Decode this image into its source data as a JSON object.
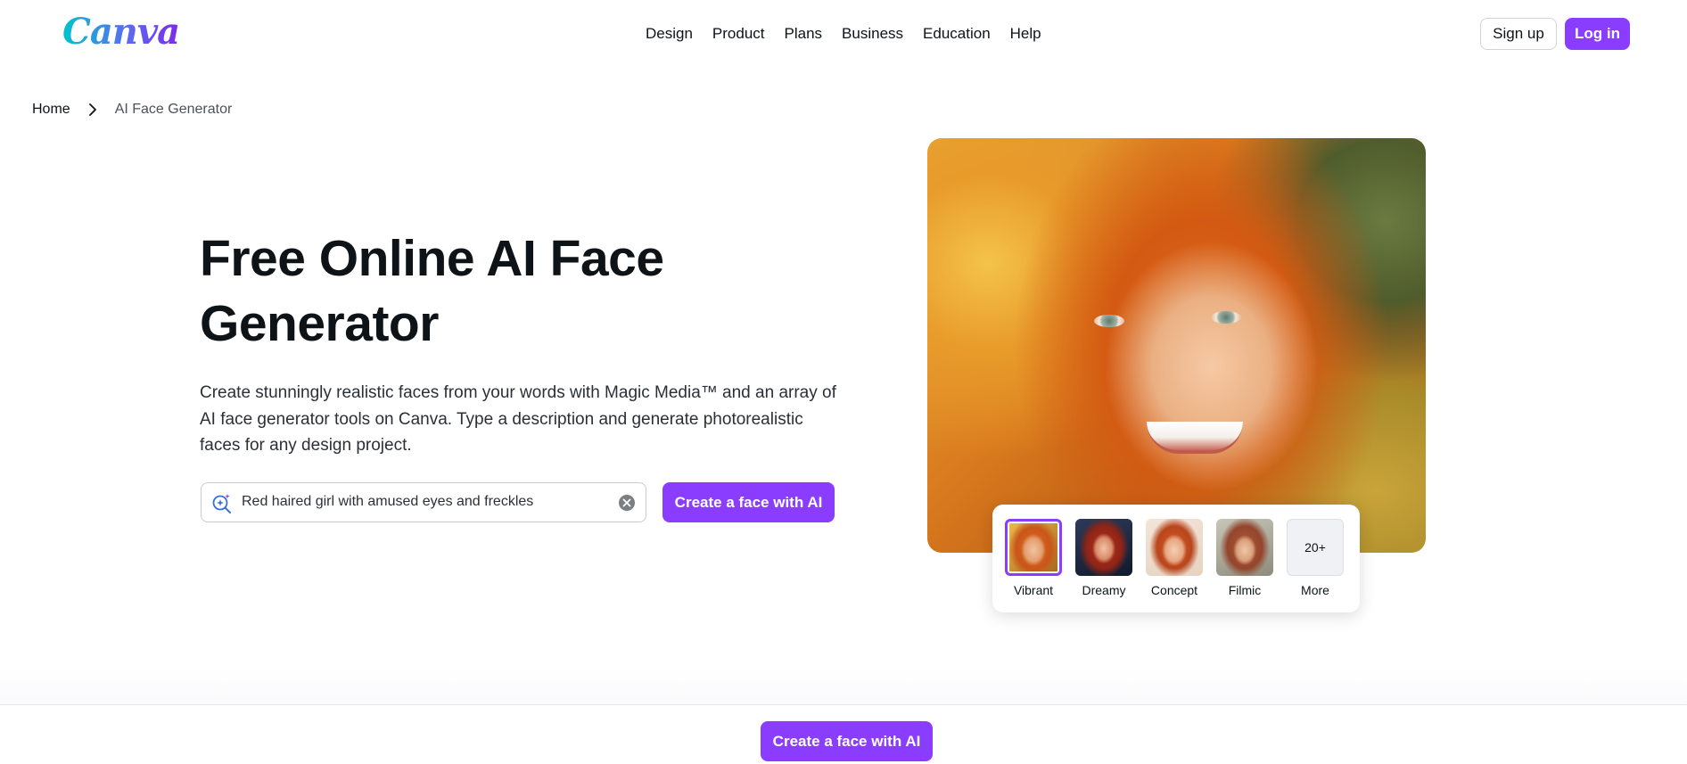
{
  "header": {
    "logo_text": "Canva",
    "nav": [
      "Design",
      "Product",
      "Plans",
      "Business",
      "Education",
      "Help"
    ],
    "signup_label": "Sign up",
    "login_label": "Log in"
  },
  "breadcrumb": {
    "home": "Home",
    "current": "AI Face Generator"
  },
  "hero": {
    "title_line1": "Free Online AI Face",
    "title_line2": "Generator",
    "description": "Create stunningly realistic faces from your words with Magic Media™ and an array of AI face generator tools on Canva. Type a description and generate photorealistic faces for any design project.",
    "search_value": "Red haired girl with amused eyes and freckles",
    "cta_label": "Create a face with AI"
  },
  "styles": {
    "selected": "Vibrant",
    "items": [
      {
        "label": "Vibrant",
        "icon": "vibrant-style-thumbnail"
      },
      {
        "label": "Dreamy",
        "icon": "dreamy-style-thumbnail"
      },
      {
        "label": "Concept",
        "icon": "concept-style-thumbnail"
      },
      {
        "label": "Filmic",
        "icon": "filmic-style-thumbnail"
      }
    ],
    "more_count": "20+",
    "more_label": "More"
  },
  "bottom_bar": {
    "cta_label": "Create a face with AI"
  },
  "colors": {
    "accent": "#8b3dff",
    "text": "#0e1318"
  }
}
